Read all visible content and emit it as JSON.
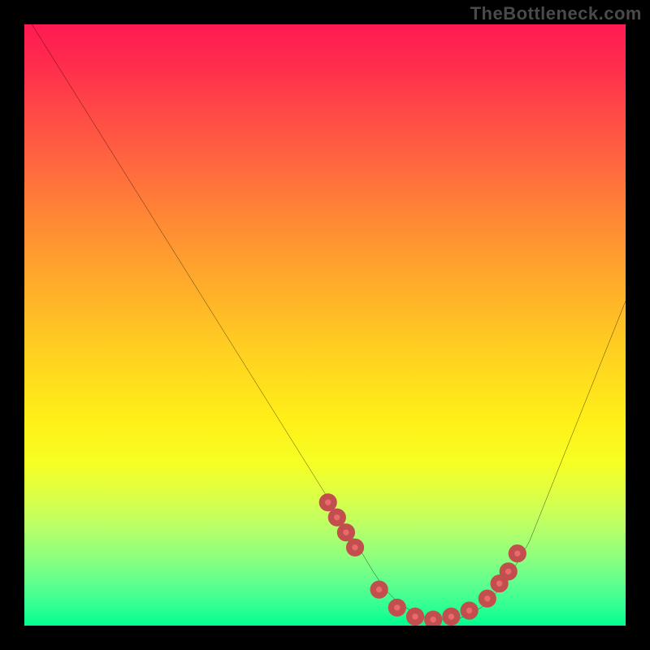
{
  "watermark": "TheBottleneck.com",
  "chart_data": {
    "type": "line",
    "title": "",
    "xlabel": "",
    "ylabel": "",
    "xlim": [
      0,
      100
    ],
    "ylim": [
      0,
      100
    ],
    "curve": {
      "name": "bottleneck-curve",
      "x": [
        0,
        5,
        10,
        15,
        20,
        25,
        30,
        35,
        40,
        45,
        50,
        55,
        58,
        60,
        62,
        65,
        68,
        72,
        76,
        80,
        84,
        88,
        92,
        96,
        100
      ],
      "y": [
        102,
        94,
        86,
        78,
        70,
        62,
        54,
        46,
        38,
        30,
        22,
        14,
        9,
        6,
        4,
        2,
        1,
        1,
        3,
        7,
        14,
        24,
        34,
        44,
        54
      ]
    },
    "highlight_points": {
      "name": "highlight-dots",
      "x": [
        50.5,
        52,
        53.5,
        55,
        59,
        62,
        65,
        68,
        71,
        74,
        77,
        79,
        80.5,
        82
      ],
      "y": [
        20.5,
        18,
        15.5,
        13,
        6,
        3,
        1.5,
        1,
        1.5,
        2.5,
        4.5,
        7,
        9,
        12
      ]
    },
    "colors": {
      "curve": "#000000",
      "dot_fill": "#e96a6a",
      "dot_stroke": "#c24e4e",
      "gradient_top": "#ff1a52",
      "gradient_bottom": "#00ff8f"
    }
  }
}
